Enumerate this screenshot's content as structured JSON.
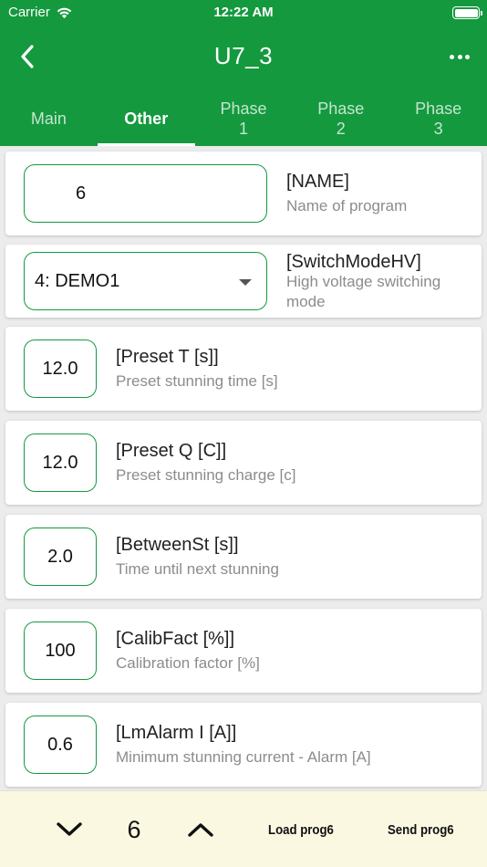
{
  "status_bar": {
    "carrier": "Carrier",
    "time": "12:22 AM"
  },
  "nav": {
    "title": "U7_3"
  },
  "tabs": [
    {
      "label": "Main",
      "active": false
    },
    {
      "label": "Other",
      "active": true
    },
    {
      "label": "Phase\n1",
      "active": false
    },
    {
      "label": "Phase\n2",
      "active": false
    },
    {
      "label": "Phase\n3",
      "active": false
    }
  ],
  "params": {
    "name": {
      "value": "6",
      "title": "[NAME]",
      "desc": "Name of program"
    },
    "switch_mode": {
      "selected": "4: DEMO1",
      "title": "[SwitchModeHV]",
      "desc": "High voltage switching mode"
    },
    "preset_t": {
      "value": "12.0",
      "title": "[Preset T [s]]",
      "desc": "Preset stunning time [s]"
    },
    "preset_q": {
      "value": "12.0",
      "title": "[Preset Q [C]]",
      "desc": "Preset stunning charge [c]"
    },
    "between_st": {
      "value": "2.0",
      "title": "[BetweenSt [s]]",
      "desc": "Time until next stunning"
    },
    "calib_fact": {
      "value": "100",
      "title": "[CalibFact [%]]",
      "desc": "Calibration factor [%]"
    },
    "lm_alarm": {
      "value": "0.6",
      "title": "[LmAlarm I [A]]",
      "desc": "Minimum stunning current - Alarm [A]"
    }
  },
  "bottom_bar": {
    "program_number": "6",
    "load_label": "Load prog6",
    "send_label": "Send prog6"
  },
  "colors": {
    "accent": "#14993f",
    "bottom_bar": "#fbf8e2"
  }
}
